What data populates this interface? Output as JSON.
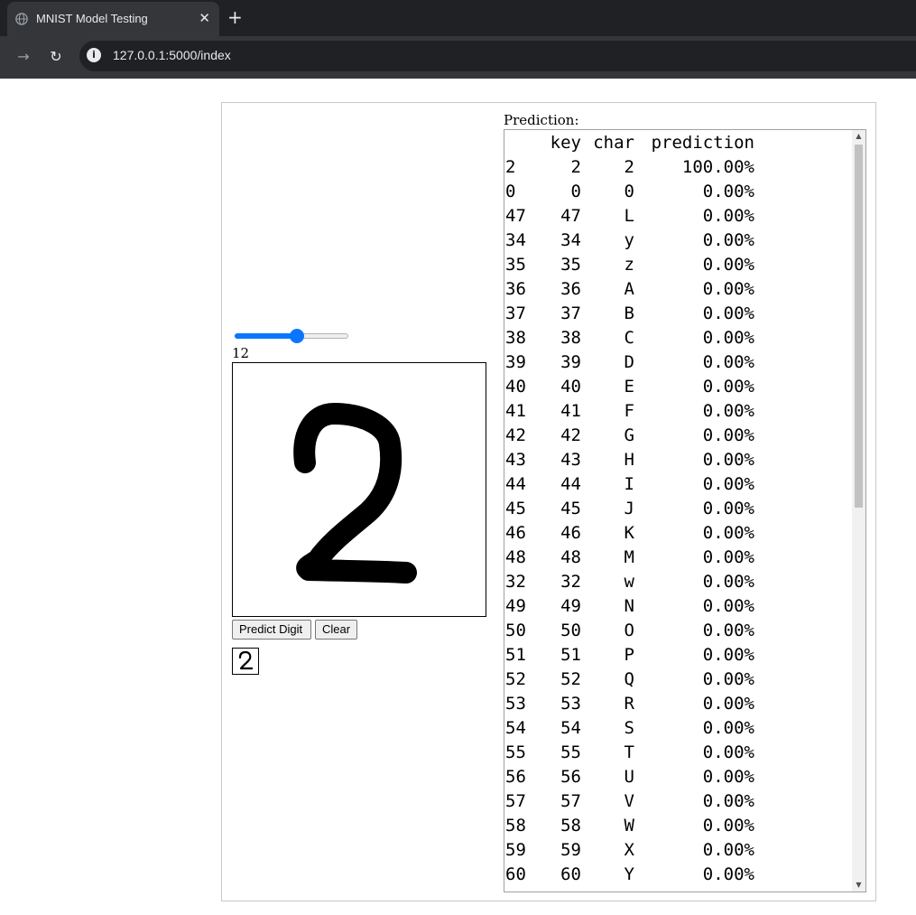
{
  "browser": {
    "tab_title": "MNIST Model Testing",
    "tab_close": "✕",
    "new_tab": "+",
    "forward_icon": "→",
    "reload_icon": "↻",
    "info_icon": "i",
    "url": "127.0.0.1:5000/index"
  },
  "controls": {
    "brush_size": "12",
    "slider_value_fraction": 0.55,
    "predict_label": "Predict Digit",
    "clear_label": "Clear"
  },
  "prediction": {
    "label": "Prediction:",
    "columns": [
      "",
      "key",
      "char",
      "prediction"
    ],
    "rows": [
      [
        "2",
        "2",
        "2",
        "100.00%"
      ],
      [
        "0",
        "0",
        "0",
        "0.00%"
      ],
      [
        "47",
        "47",
        "L",
        "0.00%"
      ],
      [
        "34",
        "34",
        "y",
        "0.00%"
      ],
      [
        "35",
        "35",
        "z",
        "0.00%"
      ],
      [
        "36",
        "36",
        "A",
        "0.00%"
      ],
      [
        "37",
        "37",
        "B",
        "0.00%"
      ],
      [
        "38",
        "38",
        "C",
        "0.00%"
      ],
      [
        "39",
        "39",
        "D",
        "0.00%"
      ],
      [
        "40",
        "40",
        "E",
        "0.00%"
      ],
      [
        "41",
        "41",
        "F",
        "0.00%"
      ],
      [
        "42",
        "42",
        "G",
        "0.00%"
      ],
      [
        "43",
        "43",
        "H",
        "0.00%"
      ],
      [
        "44",
        "44",
        "I",
        "0.00%"
      ],
      [
        "45",
        "45",
        "J",
        "0.00%"
      ],
      [
        "46",
        "46",
        "K",
        "0.00%"
      ],
      [
        "48",
        "48",
        "M",
        "0.00%"
      ],
      [
        "32",
        "32",
        "w",
        "0.00%"
      ],
      [
        "49",
        "49",
        "N",
        "0.00%"
      ],
      [
        "50",
        "50",
        "O",
        "0.00%"
      ],
      [
        "51",
        "51",
        "P",
        "0.00%"
      ],
      [
        "52",
        "52",
        "Q",
        "0.00%"
      ],
      [
        "53",
        "53",
        "R",
        "0.00%"
      ],
      [
        "54",
        "54",
        "S",
        "0.00%"
      ],
      [
        "55",
        "55",
        "T",
        "0.00%"
      ],
      [
        "56",
        "56",
        "U",
        "0.00%"
      ],
      [
        "57",
        "57",
        "V",
        "0.00%"
      ],
      [
        "58",
        "58",
        "W",
        "0.00%"
      ],
      [
        "59",
        "59",
        "X",
        "0.00%"
      ],
      [
        "60",
        "60",
        "Y",
        "0.00%"
      ]
    ]
  },
  "icons": {
    "favicon": "globe-icon",
    "scroll_up": "▲",
    "scroll_down": "▼"
  },
  "colors": {
    "slider_accent": "#0b75ff",
    "ink": "#000000"
  }
}
